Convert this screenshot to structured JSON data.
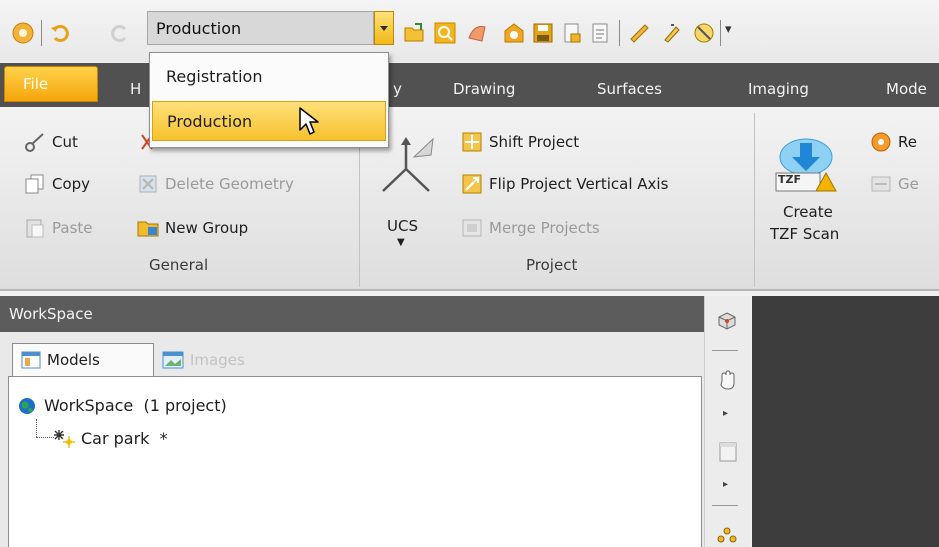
{
  "quick_access": {
    "mode_selected": "Production",
    "overflow_glyph": "▾"
  },
  "mode_dropdown": {
    "options": [
      "Registration",
      "Production"
    ],
    "highlighted_index": 1
  },
  "tabs": {
    "file": "File",
    "partial_h": "H",
    "partial_y": "y",
    "items": [
      "Drawing",
      "Surfaces",
      "Imaging",
      "Mode"
    ]
  },
  "ribbon": {
    "general": {
      "label": "General",
      "cut": "Cut",
      "copy": "Copy",
      "paste": "Paste",
      "delete_geometry": "Delete Geometry",
      "new_group": "New Group"
    },
    "project": {
      "label": "Project",
      "ucs": "UCS",
      "shift_project": "Shift Project",
      "flip_axis": "Flip Project Vertical Axis",
      "merge_projects": "Merge Projects"
    },
    "scan": {
      "create_line1": "Create",
      "create_line2": "TZF Scan",
      "tzf_badge": "TZF",
      "partial_re": "Re",
      "partial_ge": "Ge"
    }
  },
  "workspace": {
    "title": "WorkSpace",
    "tabs": [
      "Models",
      "Images"
    ],
    "tree": {
      "root": "WorkSpace  (1 project)",
      "child": "Car park  *"
    }
  },
  "colors": {
    "accent_orange": "#f5a60c",
    "tab_strip": "#515151",
    "viewport": "#3d3d3d"
  }
}
